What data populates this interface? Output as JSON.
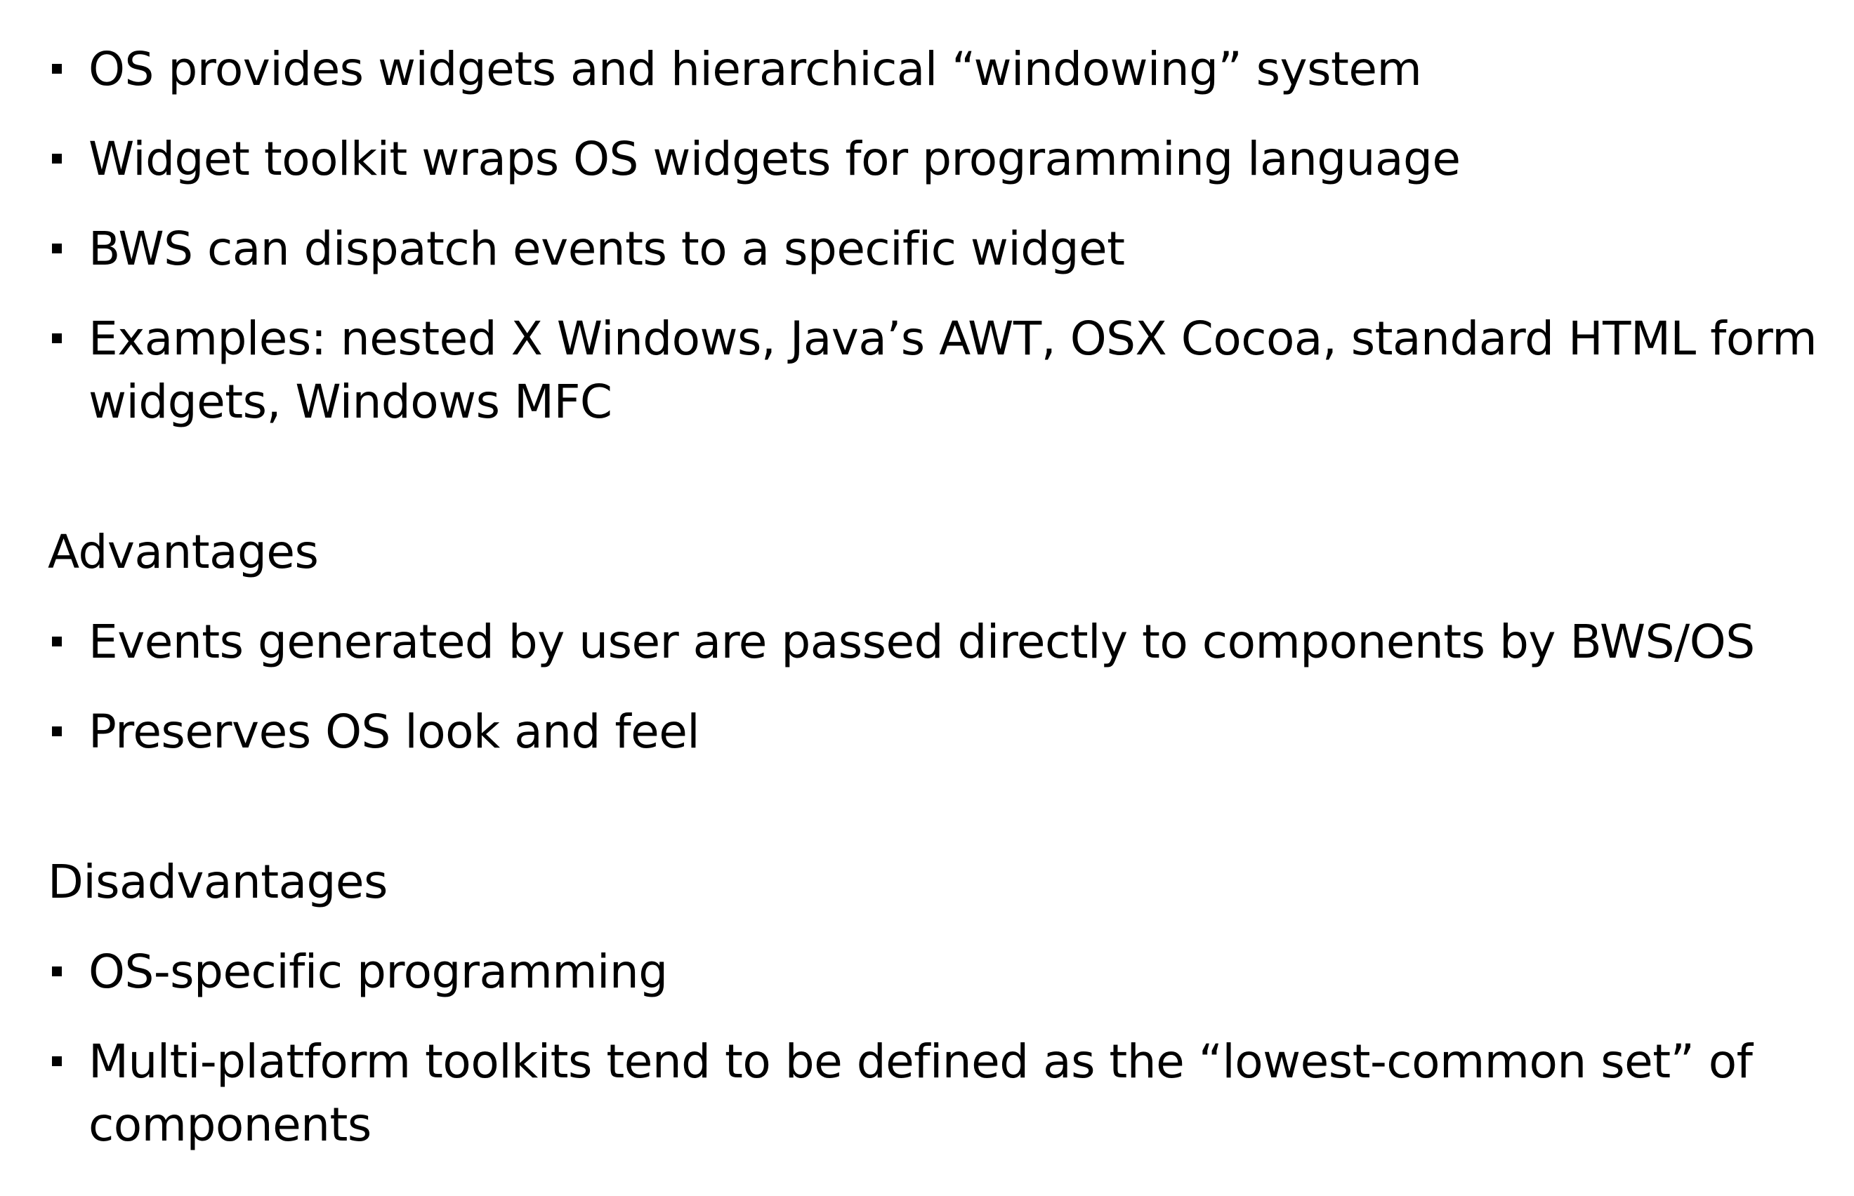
{
  "intro": {
    "items": [
      "OS provides widgets and hierarchical “windowing” system",
      "Widget toolkit wraps OS widgets for programming language",
      "BWS can dispatch events to a specific widget",
      "Examples:  nested X Windows, Java’s AWT, OSX Cocoa, standard HTML form widgets, Windows MFC"
    ]
  },
  "advantages": {
    "heading": "Advantages",
    "items": [
      "Events generated by user are passed directly to components by BWS/OS",
      "Preserves OS look and feel"
    ]
  },
  "disadvantages": {
    "heading": "Disadvantages",
    "items": [
      "OS-specific programming",
      "Multi-platform toolkits tend to be defined as the “lowest-common set” of components"
    ]
  }
}
